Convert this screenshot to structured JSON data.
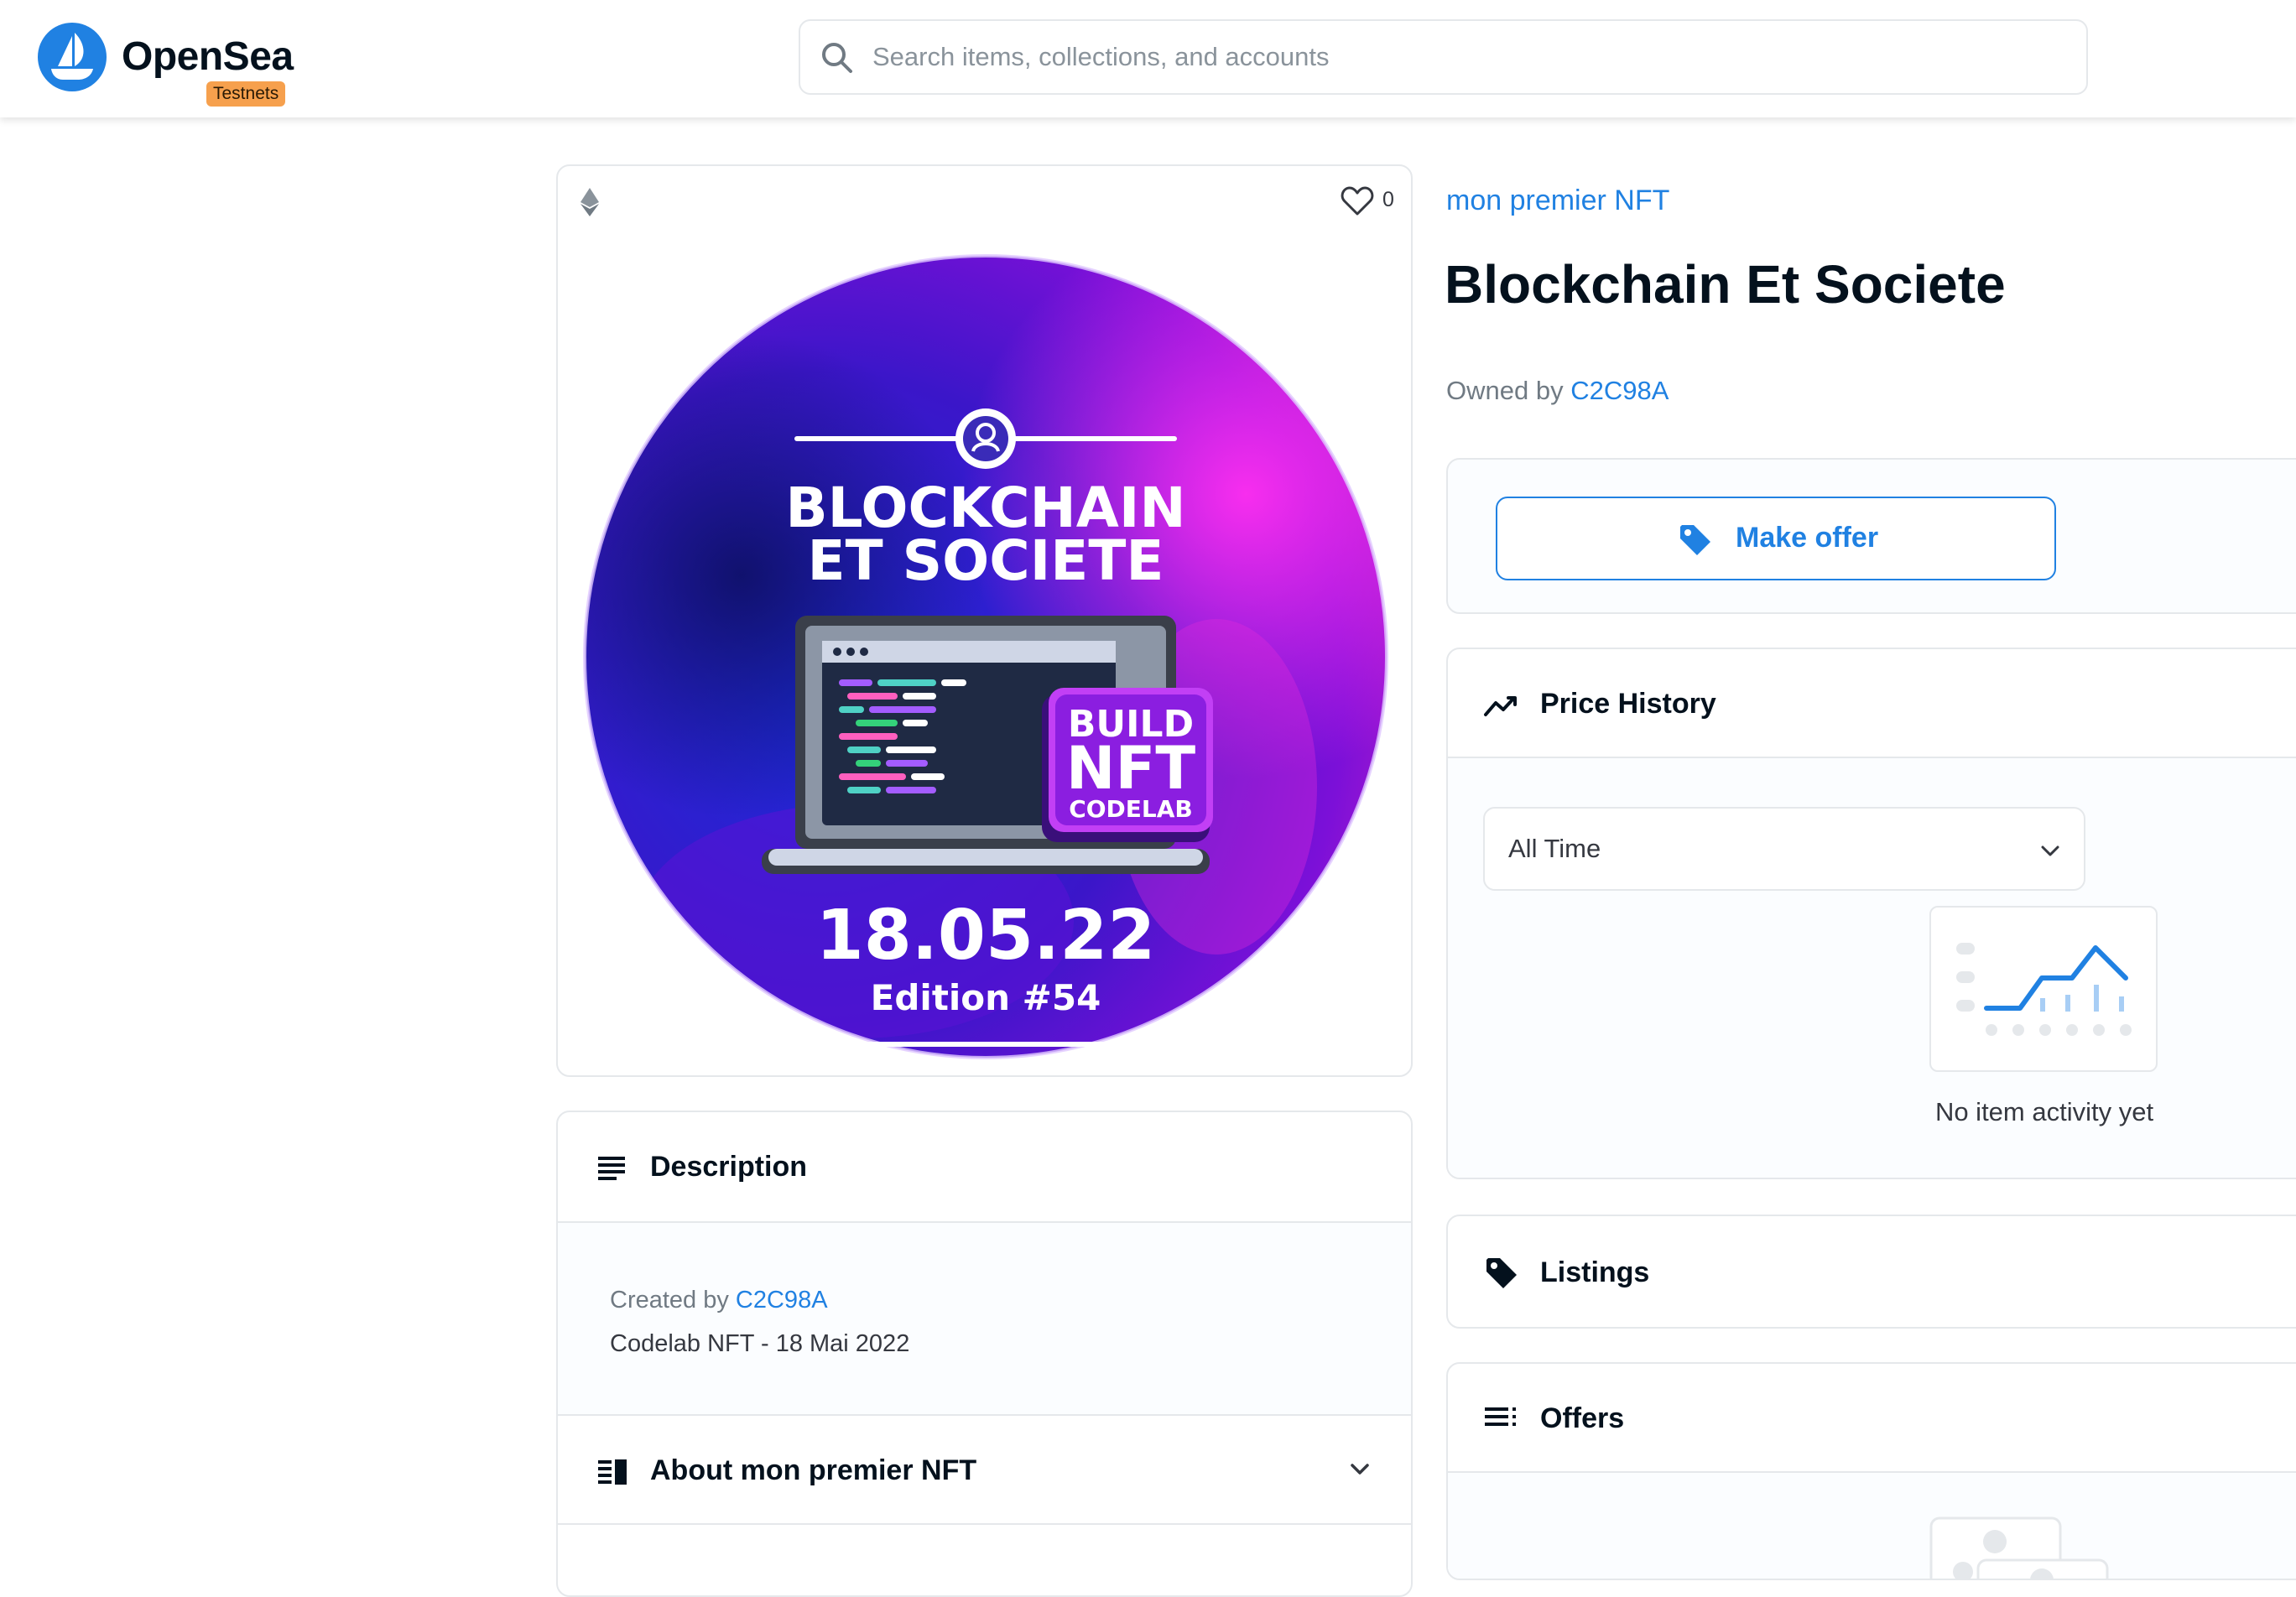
{
  "header": {
    "brand": "OpenSea",
    "badge": "Testnets",
    "search_placeholder": "Search items, collections, and accounts"
  },
  "media": {
    "favorite_count": "0",
    "image": {
      "headline_line1": "BLOCKCHAIN",
      "headline_line2": "ET SOCIETE",
      "badge_line1": "BUILD",
      "badge_line2": "NFT",
      "badge_line3": "CODELAB",
      "date": "18.05.22",
      "edition": "Edition #54"
    }
  },
  "item": {
    "collection": "mon premier NFT",
    "title": "Blockchain Et Societe",
    "owned_prefix": "Owned by",
    "owner": "C2C98A"
  },
  "description": {
    "title": "Description",
    "created_prefix": "Created by",
    "creator": "C2C98A",
    "text": "Codelab NFT - 18 Mai 2022"
  },
  "about": {
    "title": "About mon premier NFT"
  },
  "offer": {
    "button_label": "Make offer"
  },
  "price_history": {
    "title": "Price History",
    "range_selected": "All Time",
    "empty_text": "No item activity yet"
  },
  "listings": {
    "title": "Listings"
  },
  "offers": {
    "title": "Offers"
  },
  "colors": {
    "accent": "#2081e2",
    "badge": "#f6a04d",
    "border": "#e5e8eb",
    "text": "#04111d"
  }
}
